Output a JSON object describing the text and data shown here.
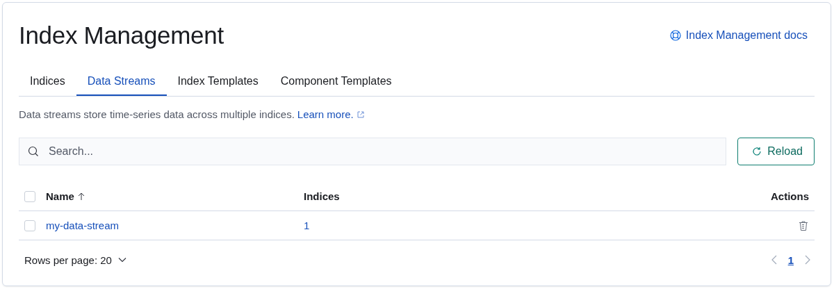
{
  "page": {
    "title": "Index Management",
    "docs_link": "Index Management docs"
  },
  "tabs": [
    {
      "label": "Indices",
      "selected": false
    },
    {
      "label": "Data Streams",
      "selected": true
    },
    {
      "label": "Index Templates",
      "selected": false
    },
    {
      "label": "Component Templates",
      "selected": false
    }
  ],
  "description": {
    "text": "Data streams store time-series data across multiple indices.",
    "link": "Learn more."
  },
  "search": {
    "placeholder": "Search..."
  },
  "reload_button": "Reload",
  "table": {
    "select_all": {
      "checked": false
    },
    "columns": [
      {
        "label": "Name",
        "sorted": true
      },
      {
        "label": "Indices",
        "sorted": false
      },
      {
        "label": "Actions",
        "sorted": false
      }
    ],
    "rows": [
      {
        "checked": false,
        "name": "my-data-stream",
        "indices": "1"
      }
    ]
  },
  "footer": {
    "rows_per_page": "Rows per page: 20",
    "pages": [
      {
        "label": "1",
        "selected": true
      }
    ]
  }
}
